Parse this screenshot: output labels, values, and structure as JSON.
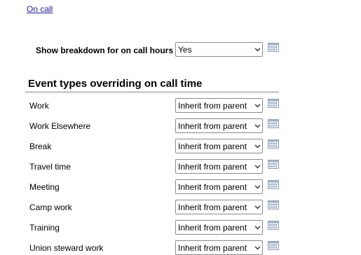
{
  "oncall_link": "On call",
  "breakdown": {
    "label": "Show breakdown for on call hours",
    "value": "Yes"
  },
  "section_title": "Event types overriding on call time",
  "event_types": [
    {
      "label": "Work",
      "value": "Inherit from parent"
    },
    {
      "label": "Work Elsewhere",
      "value": "Inherit from parent"
    },
    {
      "label": "Break",
      "value": "Inherit from parent"
    },
    {
      "label": "Travel time",
      "value": "Inherit from parent"
    },
    {
      "label": "Meeting",
      "value": "Inherit from parent"
    },
    {
      "label": "Camp work",
      "value": "Inherit from parent"
    },
    {
      "label": "Training",
      "value": "Inherit from parent"
    },
    {
      "label": "Union steward work",
      "value": "Inherit from parent"
    }
  ],
  "icons": {
    "calendar": "calendar-icon",
    "dropdown": "chevron-down-icon"
  },
  "colors": {
    "link": "#1a1aa6",
    "divider": "#cfcfcf"
  }
}
